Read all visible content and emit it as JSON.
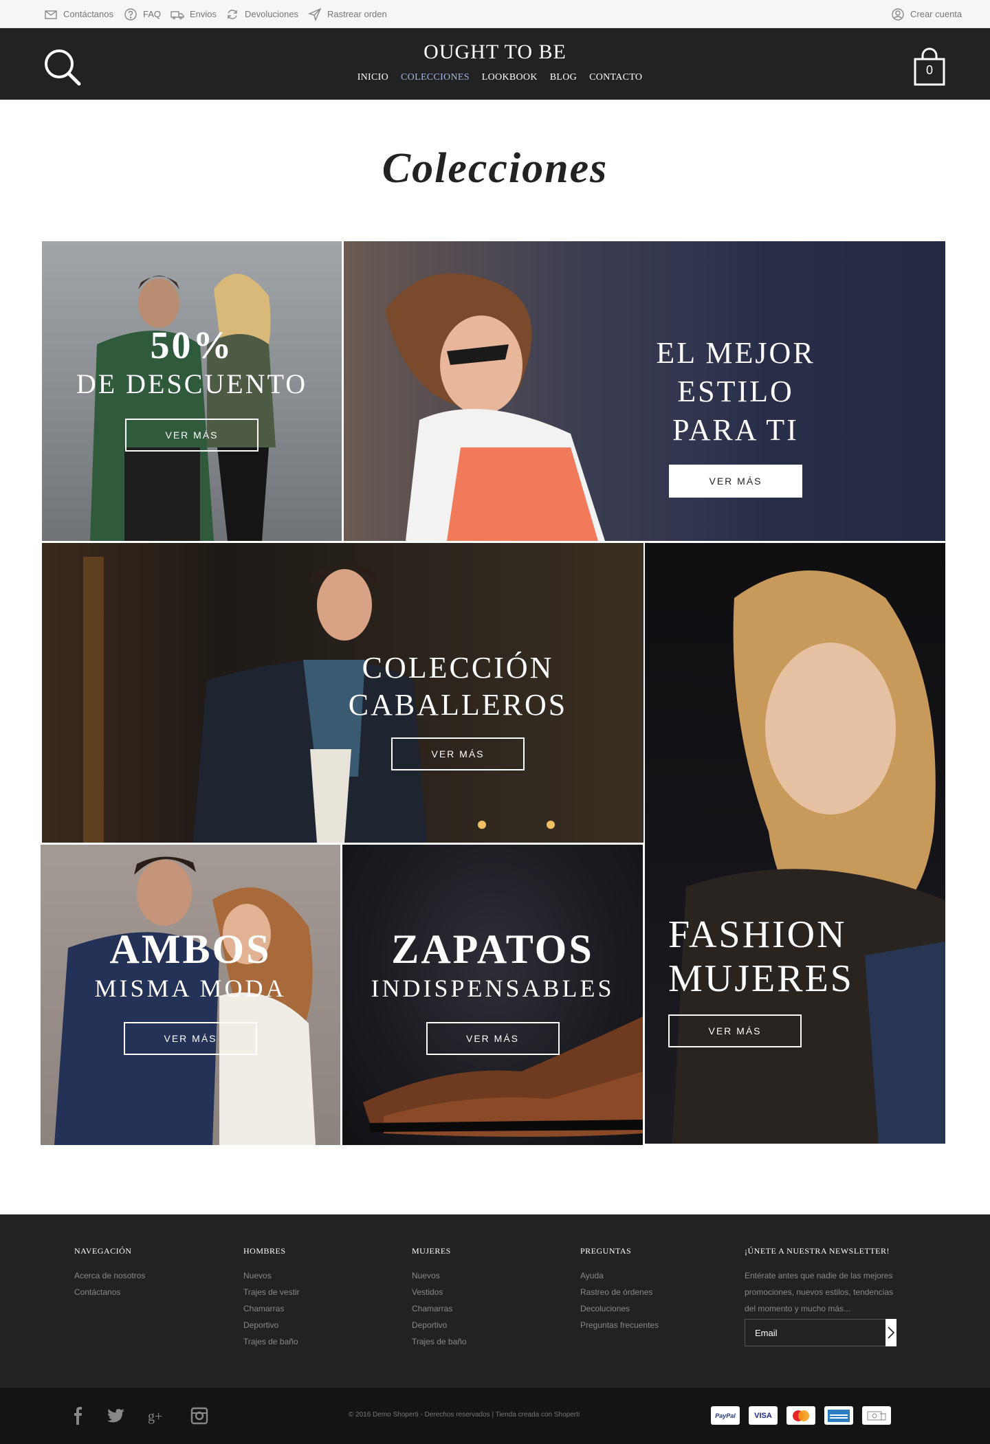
{
  "topbar": {
    "contact": "Contáctanos",
    "faq": "FAQ",
    "shipping": "Envios",
    "returns": "Devoluciones",
    "track": "Rastrear orden",
    "account": "Crear cuenta"
  },
  "header": {
    "logo": "OUGHT TO BE",
    "nav": [
      "INICIO",
      "COLECCIONES",
      "LOOKBOOK",
      "BLOG",
      "CONTACTO"
    ],
    "cart_count": "0"
  },
  "page_title": "Colecciones",
  "tiles": {
    "discount": {
      "line1": "50%",
      "line2": "DE DESCUENTO",
      "button": "VER MÁS"
    },
    "style": {
      "line1": "EL MEJOR ESTILO",
      "line2": "PARA TI",
      "button": "VER MÁS"
    },
    "men": {
      "line1": "COLECCIÓN",
      "line2": "CABALLEROS",
      "button": "VER MÁS"
    },
    "women": {
      "line1": "FASHION",
      "line2": "MUJERES",
      "button": "VER MÁS"
    },
    "both": {
      "line1": "AMBOS",
      "line2": "MISMA MODA",
      "button": "VER MÁS"
    },
    "shoes": {
      "line1": "ZAPATOS",
      "line2": "INDISPENSABLES",
      "button": "VER MÁS"
    }
  },
  "footer": {
    "navigation": {
      "title": "NAVEGACIÓN",
      "links": [
        "Acerca de nosotros",
        "Contáctanos"
      ]
    },
    "men": {
      "title": "HOMBRES",
      "links": [
        "Nuevos",
        "Trajes de vestir",
        "Chamarras",
        "Deportivo",
        "Trajes de baño"
      ]
    },
    "women": {
      "title": "MUJERES",
      "links": [
        "Nuevos",
        "Vestidos",
        "Chamarras",
        "Deportivo",
        "Trajes de baño"
      ]
    },
    "questions": {
      "title": "PREGUNTAS",
      "links": [
        "Ayuda",
        "Rastreo de órdenes",
        "Decoluciones",
        "Preguntas frecuentes"
      ]
    },
    "newsletter": {
      "title": "¡ÚNETE A NUESTRA NEWSLETTER!",
      "text": "Entérate antes que nadie de las mejores promociones, nuevos estilos, tendencias del momento y mucho más...",
      "placeholder": "Email"
    },
    "copyright": "© 2016 Demo Shoperti - Derechos reservados | Tienda creada con Shoperti",
    "payments": [
      "PayPal",
      "VISA",
      "",
      "",
      ""
    ]
  }
}
